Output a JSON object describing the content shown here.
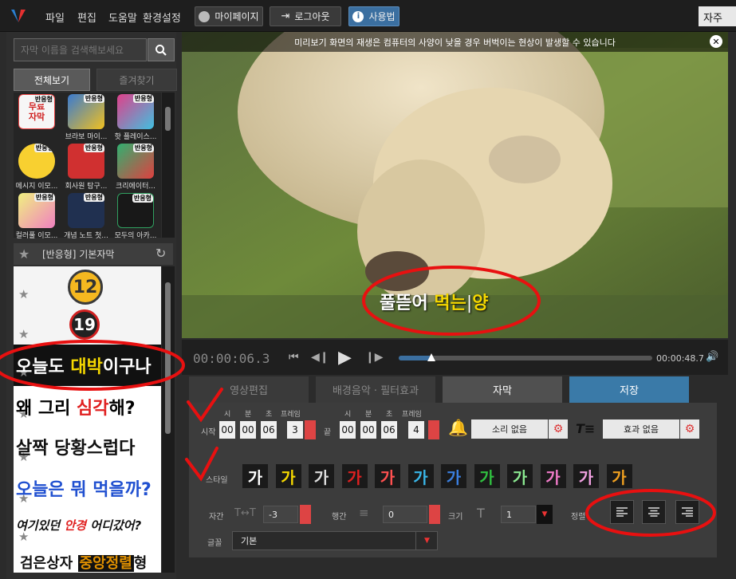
{
  "menu": [
    "파일",
    "편집",
    "도움말",
    "환경설정"
  ],
  "top_buttons": {
    "mypage": "마이페이지",
    "logout": "로그아웃",
    "usage": "사용법"
  },
  "right_tab": "자주",
  "left": {
    "search_placeholder": "자막 이름을 검색해보세요",
    "tabs": [
      "전체보기",
      "즐겨찾기"
    ],
    "grid": [
      {
        "label": "",
        "badge": "반응형",
        "thumb_text": "무료자막"
      },
      {
        "label": "브라보 마이...",
        "badge": "반응형",
        "thumb_text": ""
      },
      {
        "label": "핫 플레이스...",
        "badge": "반응형",
        "thumb_text": ""
      },
      {
        "label": "메시지 이모...",
        "badge": "반응형",
        "thumb_text": ""
      },
      {
        "label": "회사원 탐구...",
        "badge": "반응형",
        "thumb_text": ""
      },
      {
        "label": "크리에이터...",
        "badge": "반응형",
        "thumb_text": ""
      },
      {
        "label": "컬러풀 이모...",
        "badge": "반응형",
        "thumb_text": ""
      },
      {
        "label": "개념 노트 첫...",
        "badge": "반응형",
        "thumb_text": ""
      },
      {
        "label": "모두의 아카...",
        "badge": "반응형",
        "thumb_text": ""
      }
    ],
    "section_title": "[반응형] 기본자막",
    "styles": [
      {
        "parts": [
          {
            "t": "12",
            "c": "#333"
          }
        ]
      },
      {
        "parts": [
          {
            "t": "19",
            "c": "#fff"
          }
        ]
      },
      {
        "parts": [
          {
            "t": "오늘도 ",
            "c": "#fff"
          },
          {
            "t": "대박",
            "c": "#f5d800"
          },
          {
            "t": "이구나",
            "c": "#fff"
          }
        ]
      },
      {
        "parts": [
          {
            "t": "왜 그리 ",
            "c": "#000"
          },
          {
            "t": "심각",
            "c": "#e02020"
          },
          {
            "t": "해?",
            "c": "#000"
          }
        ]
      },
      {
        "parts": [
          {
            "t": "살짝 당황스럽다",
            "c": "#111"
          }
        ]
      },
      {
        "parts": [
          {
            "t": "오늘은 뭐 먹을까?",
            "c": "#2050d0"
          }
        ]
      },
      {
        "parts": [
          {
            "t": "여기있던 ",
            "c": "#111"
          },
          {
            "t": "안경",
            "c": "#e02020"
          },
          {
            "t": " 어디갔어?",
            "c": "#111"
          }
        ]
      },
      {
        "parts": [
          {
            "t": "검은상자 ",
            "c": "#111"
          },
          {
            "t": "중앙정렬",
            "c": "#e09000"
          },
          {
            "t": "형",
            "c": "#111"
          }
        ]
      }
    ]
  },
  "preview": {
    "notice": "미리보기 화면의 재생은 컴퓨터의 사양이 낮을 경우 버벅이는 현상이 발생할 수 있습니다",
    "subtitle_parts": [
      {
        "t": "풀뜯어 ",
        "hl": false
      },
      {
        "t": "먹는",
        "hl": true
      },
      {
        "t": "양",
        "hl": true
      }
    ]
  },
  "transport": {
    "current": "00:00:06.3",
    "end": "00:00:48.7",
    "progress": 0.13
  },
  "tabs": [
    "영상편집",
    "배경음악 · 필터효과",
    "자막",
    "저장"
  ],
  "edit": {
    "time_headers": [
      "시",
      "분",
      "초",
      "프레임"
    ],
    "start_label": "시작",
    "end_label": "끝",
    "start": [
      "00",
      "00",
      "06",
      "3"
    ],
    "end": [
      "00",
      "00",
      "06",
      "4"
    ],
    "sound_button": "소리 없음",
    "effect_button": "효과 없음",
    "style_label": "스타일",
    "style_swatch_text": "가",
    "letter_spacing_label": "자간",
    "letter_spacing_value": "-3",
    "line_spacing_label": "행간",
    "line_spacing_value": "0",
    "size_label": "크기",
    "size_value": "1",
    "align_label": "정렬",
    "font_label": "글꼴",
    "font_value": "기본"
  },
  "colors": {
    "accent": "#3b6fa0",
    "highlight": "#f5d800",
    "annotation": "#e81010",
    "swatches": [
      "#ffffff",
      "#f5d800",
      "#dddddd",
      "#e02020",
      "#ff5050",
      "#39b6e8",
      "#3a7fe0",
      "#30c040",
      "#8ae890",
      "#f07ac8",
      "#f0a0e0",
      "#f0a020"
    ]
  }
}
